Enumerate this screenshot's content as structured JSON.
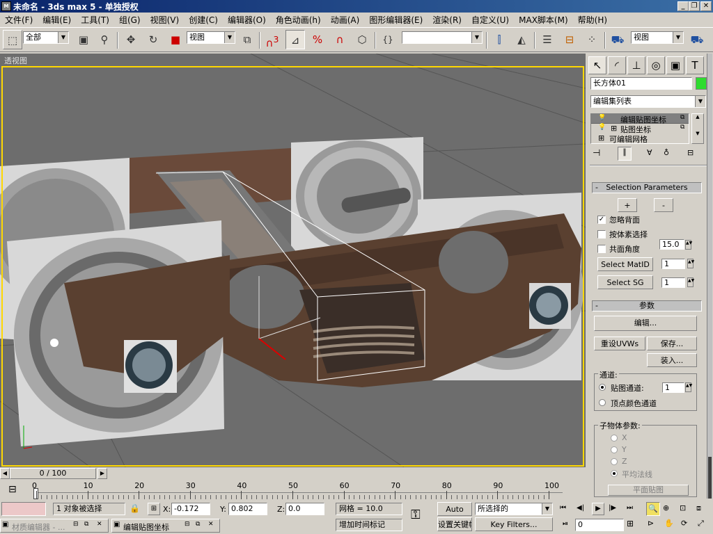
{
  "window": {
    "title": "未命名 - 3ds max 5 - 单独授权",
    "app_icon": "max-logo-icon"
  },
  "menu": [
    "文件(F)",
    "编辑(E)",
    "工具(T)",
    "组(G)",
    "视图(V)",
    "创建(C)",
    "编辑器(O)",
    "角色动画(h)",
    "动画(A)",
    "图形编辑器(E)",
    "渲染(R)",
    "自定义(U)",
    "MAX脚本(M)",
    "帮助(H)"
  ],
  "toolbar": {
    "selection_filter": "全部",
    "coord_system": "视图",
    "named_selection": "",
    "render_view": "视图",
    "snap_label": "3",
    "angle_snap_label": "%"
  },
  "viewport": {
    "label": "透视图",
    "border_color": "#ffd800"
  },
  "panel": {
    "object_name": "长方体01",
    "object_color": "#2fdc2f",
    "modifier_list": "编辑集列表",
    "stack": [
      "编辑贴图坐标",
      "贴图坐标",
      "可编辑网格"
    ],
    "selection_rollout": {
      "title": "Selection Parameters",
      "plus": "+",
      "minus": "-",
      "ignore_backfaces": "忽略背面",
      "ignore_backfaces_checked": true,
      "by_element": "按体素选择",
      "planar_angle": "共面角度",
      "planar_value": "15.0",
      "select_matid": "Select MatID",
      "matid_value": "1",
      "select_sg": "Select SG",
      "sg_value": "1"
    },
    "params_rollout": {
      "title": "参数",
      "edit": "编辑...",
      "reset_uvws": "重设UVWs",
      "save": "保存...",
      "load": "装入...",
      "channel_group": "通道:",
      "map_channel": "贴图通道:",
      "map_channel_value": "1",
      "vertex_color_channel": "顶点颜色通道",
      "subobject_group": "子物体参数:",
      "axis_x": "X",
      "axis_y": "Y",
      "axis_z": "Z",
      "average_normals": "平均法线",
      "planar_map": "平面贴图"
    }
  },
  "timeline": {
    "frame_display": "0 / 100",
    "ticks": [
      "0",
      "10",
      "20",
      "30",
      "40",
      "50",
      "60",
      "70",
      "80",
      "90",
      "100"
    ]
  },
  "status": {
    "selection": "1 对象被选择",
    "x_label": "X:",
    "x_value": "-0.172",
    "y_label": "Y:",
    "y_value": "0.802",
    "z_label": "Z:",
    "z_value": "0.0",
    "grid": "网格 = 10.0",
    "auto_key": "Auto Key",
    "set_key": "设置关键帧",
    "key_mode": "所选择的",
    "key_filters": "Key Filters...",
    "add_time_tag": "增加时间标记",
    "current_frame": "0",
    "taskbar_1": "材质编辑器 - ...",
    "taskbar_2": "编辑贴图坐标"
  }
}
